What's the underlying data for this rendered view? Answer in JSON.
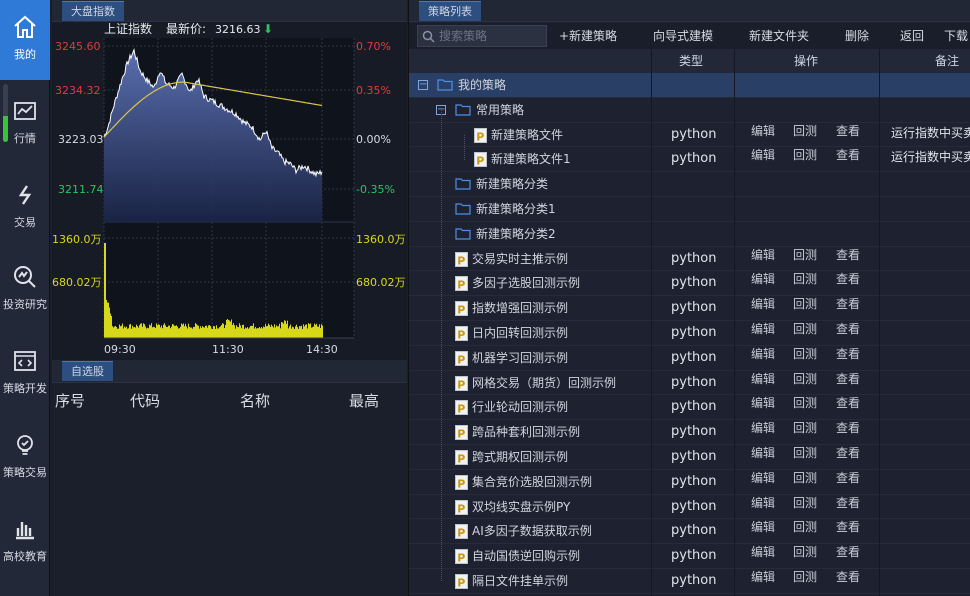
{
  "nav": [
    {
      "label": "我的",
      "icon": "home-icon",
      "active": true
    },
    {
      "label": "行情",
      "icon": "market-chart-icon"
    },
    {
      "label": "交易",
      "icon": "exchange-arrows-icon"
    },
    {
      "label": "投资研究",
      "icon": "magnifier-chart-icon"
    },
    {
      "label": "策略开发",
      "icon": "code-window-icon"
    },
    {
      "label": "策略交易",
      "icon": "lightbulb-icon"
    },
    {
      "label": "高校教育",
      "icon": "building-bars-icon"
    }
  ],
  "market": {
    "tab": "大盘指数",
    "index_name": "上证指数",
    "latest_label": "最新价:",
    "latest_price": "3216.63",
    "price_ticks_left": [
      "3245.60",
      "3234.32",
      "3223.03",
      "3211.74"
    ],
    "pct_ticks_right": [
      "0.70%",
      "0.35%",
      "0.00%",
      "-0.35%"
    ],
    "vol_ticks_left": [
      "1360.0万",
      "680.02万"
    ],
    "vol_ticks_right": [
      "1360.0万",
      "680.02万"
    ],
    "time_ticks": [
      "09:30",
      "11:30",
      "14:30"
    ]
  },
  "watchlist": {
    "tab": "自选股",
    "columns": [
      "序号",
      "代码",
      "名称",
      "最高"
    ]
  },
  "strategy": {
    "tab": "策略列表",
    "search_placeholder": "搜索策略",
    "toolbar": [
      "+新建策略",
      "向导式建模",
      "新建文件夹",
      "删除",
      "返回",
      "下载"
    ],
    "columns": {
      "type": "类型",
      "ops": "操作",
      "note": "备注"
    },
    "op_labels": [
      "编辑",
      "回测",
      "查看"
    ],
    "rows": [
      {
        "kind": "root",
        "name": "我的策略"
      },
      {
        "kind": "folder-open",
        "name": "常用策略"
      },
      {
        "kind": "file-deep",
        "name": "新建策略文件",
        "type": "python",
        "note": "运行指数中买卖"
      },
      {
        "kind": "file-deep",
        "name": "新建策略文件1",
        "type": "python",
        "note": "运行指数中买卖"
      },
      {
        "kind": "folder",
        "name": "新建策略分类"
      },
      {
        "kind": "folder",
        "name": "新建策略分类1"
      },
      {
        "kind": "folder",
        "name": "新建策略分类2"
      },
      {
        "kind": "file",
        "name": "交易实时主推示例",
        "type": "python"
      },
      {
        "kind": "file",
        "name": "多因子选股回测示例",
        "type": "python"
      },
      {
        "kind": "file",
        "name": "指数增强回测示例",
        "type": "python"
      },
      {
        "kind": "file",
        "name": "日内回转回测示例",
        "type": "python"
      },
      {
        "kind": "file",
        "name": "机器学习回测示例",
        "type": "python"
      },
      {
        "kind": "file",
        "name": "网格交易（期货）回测示例",
        "type": "python"
      },
      {
        "kind": "file",
        "name": "行业轮动回测示例",
        "type": "python"
      },
      {
        "kind": "file",
        "name": "跨品种套利回测示例",
        "type": "python"
      },
      {
        "kind": "file",
        "name": "跨式期权回测示例",
        "type": "python"
      },
      {
        "kind": "file",
        "name": "集合竞价选股回测示例",
        "type": "python"
      },
      {
        "kind": "file",
        "name": "双均线实盘示例PY",
        "type": "python"
      },
      {
        "kind": "file",
        "name": "AI多因子数据获取示例",
        "type": "python"
      },
      {
        "kind": "file",
        "name": "自动国债逆回购示例",
        "type": "python"
      },
      {
        "kind": "file",
        "name": "隔日文件挂单示例",
        "type": "python"
      }
    ]
  },
  "colors": {
    "accent": "#2f7ad7",
    "up": "#e23b3b",
    "down": "#2fc35f",
    "volume": "#d8d81a",
    "avg": "#d9c54a"
  }
}
